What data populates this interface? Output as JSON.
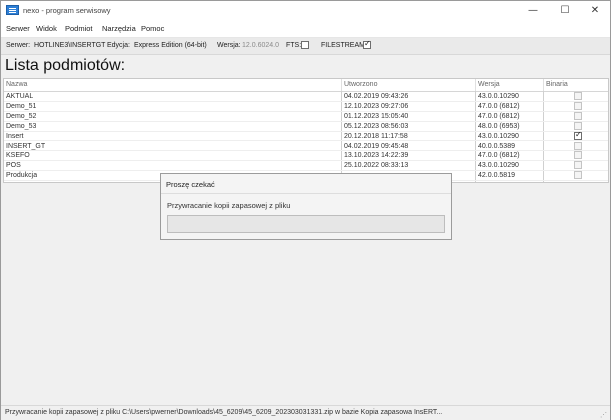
{
  "window": {
    "title": "nexo - program serwisowy",
    "controls": {
      "minimize": "—",
      "maximize": "☐",
      "close": "✕"
    }
  },
  "menu": {
    "items": [
      "Serwer",
      "Widok",
      "Podmiot",
      "Narzędzia",
      "Pomoc"
    ]
  },
  "infobar": {
    "server_label": "Serwer:",
    "server_value": "HOTLINE3\\INSERTGT",
    "edition_label": "Edycja:",
    "edition_value": "Express Edition (64-bit)",
    "version_label": "Wersja:",
    "version_value": "12.0.6024.0",
    "fts_label": "FTS:",
    "fts_checked": false,
    "filestream_label": "FILESTREAM:",
    "filestream_checked": true
  },
  "page": {
    "title": "Lista podmiotów:"
  },
  "table": {
    "columns": [
      "Nazwa",
      "Utworzono",
      "Wersja",
      "Binaria"
    ],
    "rows": [
      {
        "name": "AKTUAL",
        "created": "04.02.2019 09:43:26",
        "version": "43.0.0.10290",
        "binaria": false
      },
      {
        "name": "Demo_51",
        "created": "12.10.2023 09:27:06",
        "version": "47.0.0 (6812)",
        "binaria": false
      },
      {
        "name": "Demo_52",
        "created": "01.12.2023 15:05:40",
        "version": "47.0.0 (6812)",
        "binaria": false
      },
      {
        "name": "Demo_53",
        "created": "05.12.2023 08:56:03",
        "version": "48.0.0 (6953)",
        "binaria": false
      },
      {
        "name": "Insert",
        "created": "20.12.2018 11:17:58",
        "version": "43.0.0.10290",
        "binaria": true
      },
      {
        "name": "INSERT_GT",
        "created": "04.02.2019 09:45:48",
        "version": "40.0.0.5389",
        "binaria": false
      },
      {
        "name": "KSEFO",
        "created": "13.10.2023 14:22:39",
        "version": "47.0.0 (6812)",
        "binaria": false
      },
      {
        "name": "POS",
        "created": "25.10.2022 08:33:13",
        "version": "43.0.0.10290",
        "binaria": false
      },
      {
        "name": "Produkcja",
        "created": "",
        "version": "42.0.0.5819",
        "binaria": false
      }
    ]
  },
  "dialog": {
    "title": "Proszę czekać",
    "message": "Przywracanie kopii zapasowej z pliku",
    "progress": 0
  },
  "status": {
    "text": "Przywracanie kopii zapasowej z pliku C:\\Users\\pwerner\\Downloads\\45_6209\\45_6209_202303031331.zip w bazie Kopia zapasowa InsERT..."
  },
  "colors": {
    "progress": "#06b025",
    "accent": "#2d7fd6"
  }
}
